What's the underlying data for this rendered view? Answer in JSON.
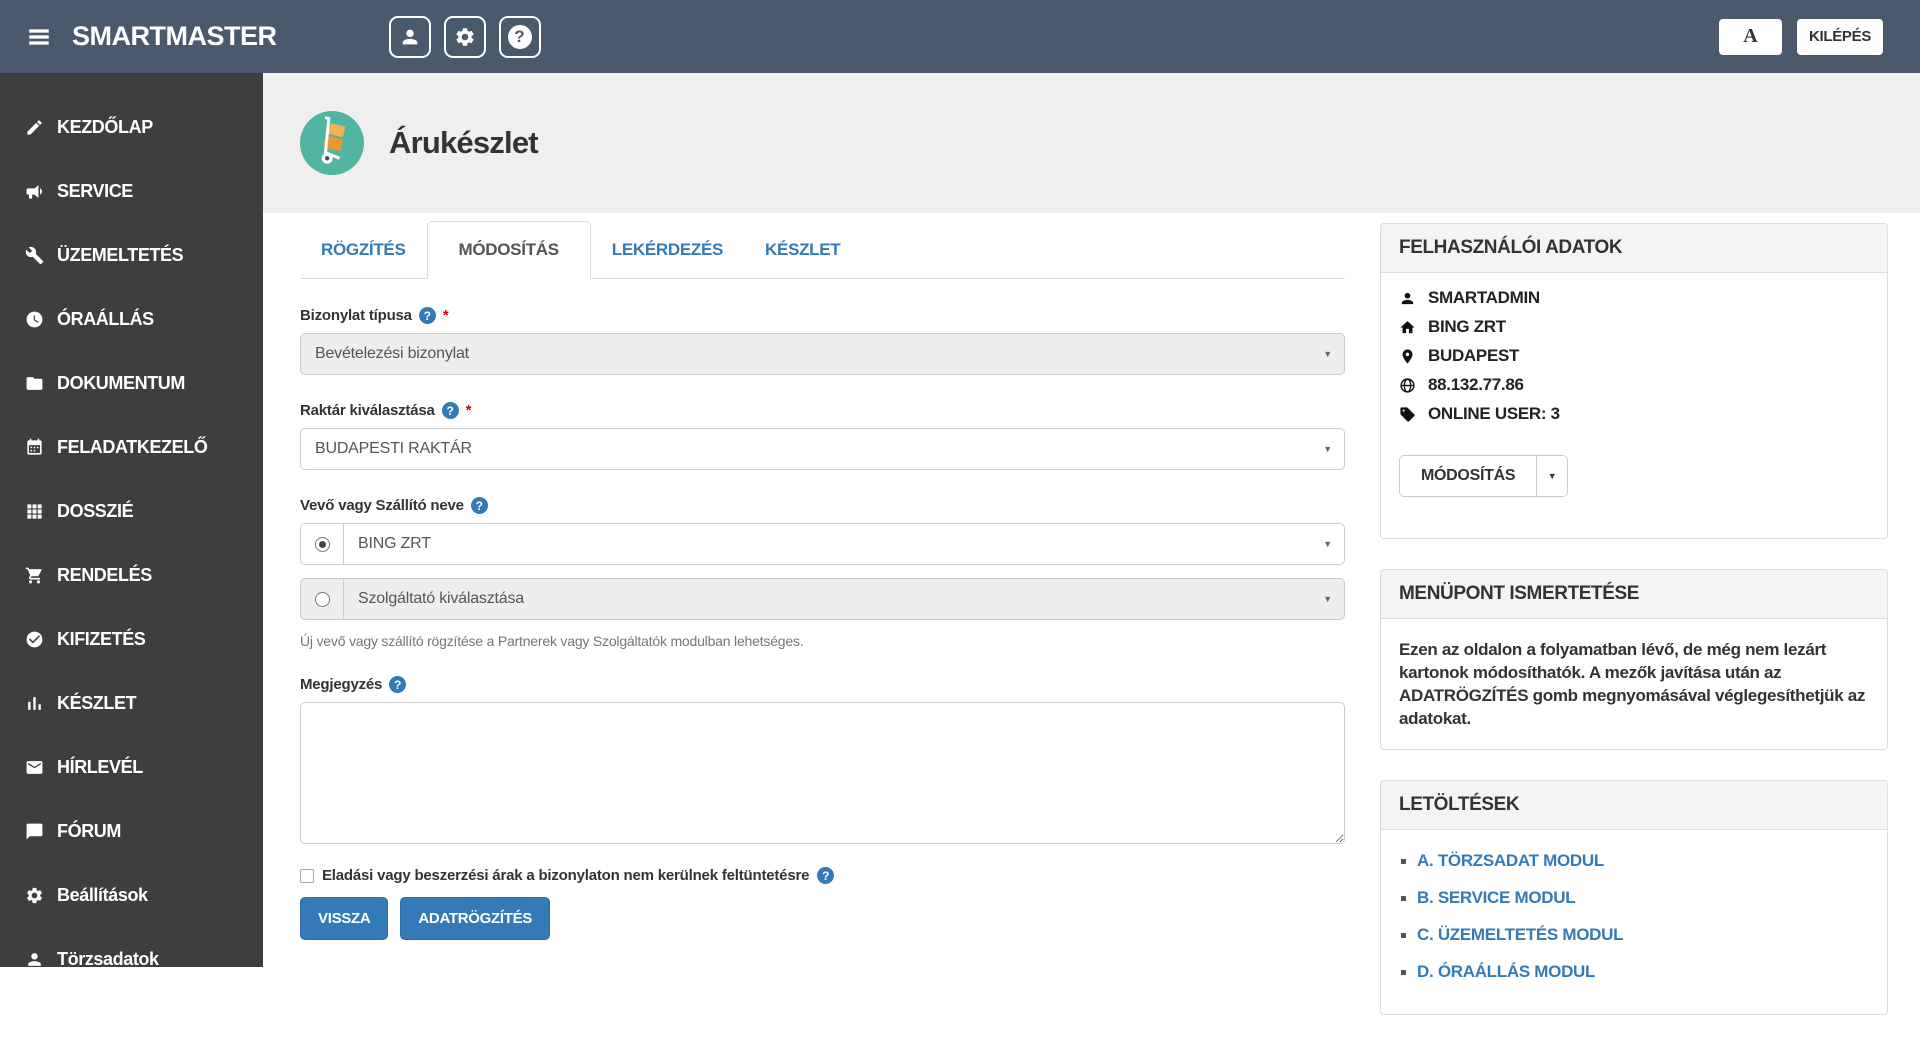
{
  "header": {
    "brand": "SMARTMASTER",
    "font_button_label": "A",
    "logout_label": "KILÉPÉS"
  },
  "glyphs": {
    "question": "?",
    "caret_down": "▼"
  },
  "colors": {
    "header_bg": "#4a5a6c",
    "sidebar_bg": "#3e3e3e",
    "accent_blue": "#337ab7",
    "title_icon_teal": "#52b5a4",
    "band_bg": "#efefef",
    "required_red": "#cc0000"
  },
  "sidebar": {
    "items": [
      {
        "label": "KEZDŐLAP",
        "icon": "edit-icon"
      },
      {
        "label": "SERVICE",
        "icon": "megaphone-icon"
      },
      {
        "label": "ÜZEMELTETÉS",
        "icon": "wrench-icon"
      },
      {
        "label": "ÓRAÁLLÁS",
        "icon": "clock-icon"
      },
      {
        "label": "DOKUMENTUM",
        "icon": "folder-icon"
      },
      {
        "label": "FELADATKEZELŐ",
        "icon": "calendar-icon"
      },
      {
        "label": "DOSSZIÉ",
        "icon": "grid-icon"
      },
      {
        "label": "RENDELÉS",
        "icon": "cart-icon"
      },
      {
        "label": "KIFIZETÉS",
        "icon": "check-circle-icon"
      },
      {
        "label": "KÉSZLET",
        "icon": "bar-chart-icon"
      },
      {
        "label": "HÍRLEVÉL",
        "icon": "envelope-icon"
      },
      {
        "label": "FÓRUM",
        "icon": "comment-icon"
      },
      {
        "label": "Beállítások",
        "icon": "gear-icon"
      },
      {
        "label": "Törzsadatok",
        "icon": "user-icon"
      }
    ]
  },
  "page": {
    "title": "Árukészlet",
    "tabs": [
      {
        "label": "RÖGZÍTÉS"
      },
      {
        "label": "MÓDOSÍTÁS"
      },
      {
        "label": "LEKÉRDEZÉS"
      },
      {
        "label": "KÉSZLET"
      }
    ]
  },
  "form": {
    "bizonylat_label": "Bizonylat típusa",
    "bizonylat_value": "Bevételezési bizonylat",
    "raktar_label": "Raktár kiválasztása",
    "raktar_value": "BUDAPESTI RAKTÁR",
    "partner_label": "Vevő vagy Szállító neve",
    "partner_value": "BING ZRT",
    "szolgaltato_value": "Szolgáltató kiválasztása",
    "partner_help": "Új vevő vagy szállító rögzítése a Partnerek vagy Szolgáltatók modulban lehetséges.",
    "megjegyzes_label": "Megjegyzés",
    "megjegyzes_value": "",
    "checkbox_label": "Eladási vagy beszerzési árak a bizonylaton nem kerülnek feltüntetésre",
    "back_button": "VISSZA",
    "submit_button": "ADATRÖGZÍTÉS"
  },
  "user_panel": {
    "title": "FELHASZNÁLÓI ADATOK",
    "items": [
      {
        "icon": "user-icon",
        "value": "SMARTADMIN"
      },
      {
        "icon": "home-icon",
        "value": "BING ZRT"
      },
      {
        "icon": "map-marker-icon",
        "value": "BUDAPEST"
      },
      {
        "icon": "globe-icon",
        "value": "88.132.77.86"
      },
      {
        "icon": "tags-icon",
        "value": "ONLINE USER: 3"
      }
    ],
    "modify_button": "MÓDOSÍTÁS"
  },
  "info_panel": {
    "title": "MENÜPONT ISMERTETÉSE",
    "text": "Ezen az oldalon a folyamatban lévő, de még nem lezárt kartonok módosíthatók. A mezők javítása után az ADATRÖGZÍTÉS gomb megnyomásával véglegesíthetjük az adatokat."
  },
  "downloads_panel": {
    "title": "LETÖLTÉSEK",
    "links": [
      {
        "label": "A. TÖRZSADAT MODUL"
      },
      {
        "label": "B. SERVICE MODUL"
      },
      {
        "label": "C. ÜZEMELTETÉS MODUL"
      },
      {
        "label": "D. ÓRAÁLLÁS MODUL"
      }
    ]
  }
}
